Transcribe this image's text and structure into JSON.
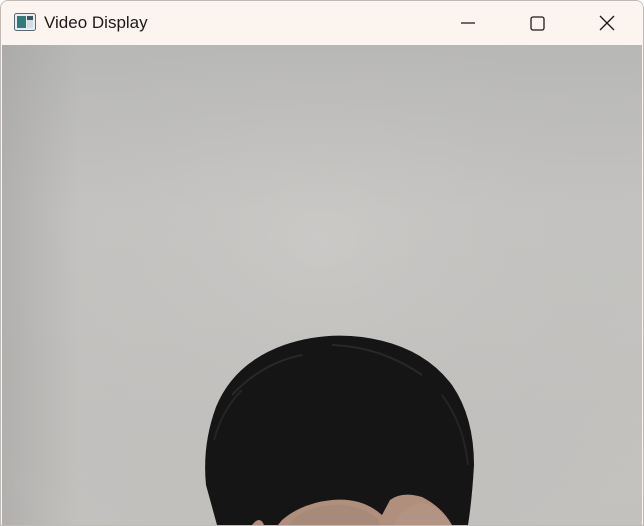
{
  "window": {
    "title": "Video Display",
    "icon": "video-window-icon",
    "controls": {
      "minimize_icon": "minimize-icon",
      "maximize_icon": "maximize-icon",
      "close_icon": "close-icon"
    }
  },
  "video": {
    "content": "webcam-frame"
  },
  "colors": {
    "titlebar_bg": "#fbf4ef",
    "wall": "#c3c2c0",
    "hair": "#151515",
    "skin": "#b79683"
  }
}
